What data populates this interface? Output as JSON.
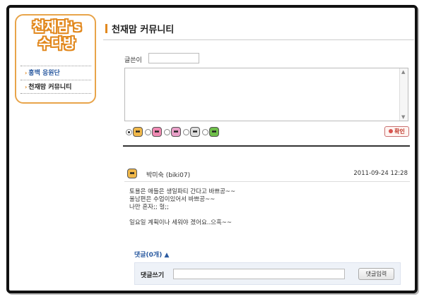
{
  "sidebar": {
    "logo_line1": "천재맘's",
    "logo_line2": "수다방",
    "items": [
      {
        "label": "홍백 응원단"
      },
      {
        "label": "천재맘 커뮤니티"
      }
    ]
  },
  "page": {
    "title": "천재맘 커뮤니티"
  },
  "form": {
    "author_label": "글쓴이",
    "author_value": "",
    "content_value": "",
    "confirm_label": "확인",
    "emoticons": [
      {
        "name": "bear",
        "color": "#f0b84a",
        "checked": true
      },
      {
        "name": "pig-pink",
        "color": "#f08ab4",
        "checked": false
      },
      {
        "name": "bunny",
        "color": "#e8a0c8",
        "checked": false
      },
      {
        "name": "panda",
        "color": "#dddddd",
        "checked": false
      },
      {
        "name": "frog",
        "color": "#6fbf4a",
        "checked": false
      }
    ]
  },
  "post": {
    "author": "박미숙 (biki07)",
    "date": "2011-09-24 12:28",
    "lines": [
      "토욜은 애들은 생일파티 간다고 바쁘공~~",
      "울남편은 수업이있어서 바쁘공~~",
      "나만 혼자;; 헐;;",
      "",
      "일요일 계획이나 세워야 겠어요..으흑~~"
    ]
  },
  "reply": {
    "toggle_label": "댓글(0개) ▲",
    "label": "댓글쓰기",
    "value": "",
    "submit_label": "댓글입력"
  },
  "colors": {
    "accent_orange": "#e2891f",
    "link_blue": "#2a5aa0",
    "reply_bg": "#eef2f8"
  }
}
